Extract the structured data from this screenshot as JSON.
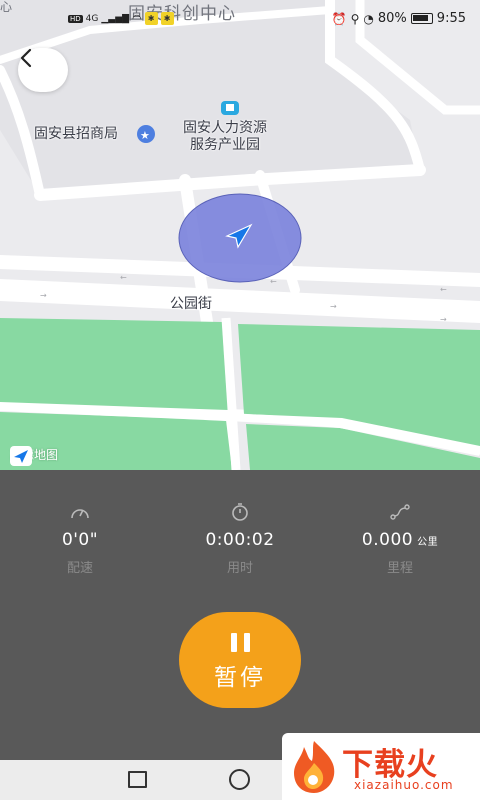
{
  "status_bar": {
    "network_badge": "HD",
    "network_type": "4G",
    "battery": "80%",
    "time": "9:55"
  },
  "map": {
    "top_label": "固安科创中心",
    "corner_fragment": "心",
    "poi_merchant": "固安县招商局",
    "poi_hr_line1": "固安人力资源",
    "poi_hr_line2": "服务产业园",
    "street_label": "公园街",
    "provider_label": "高德地图"
  },
  "stats": {
    "pace": {
      "value": "0'0\"",
      "label": "配速"
    },
    "time": {
      "value": "0:00:02",
      "label": "用时"
    },
    "distance": {
      "value": "0.000",
      "unit": "公里",
      "label": "里程"
    }
  },
  "control": {
    "pause_label": "暂停"
  },
  "watermark": {
    "text": "下载火",
    "sub": "xiazaihuo.com"
  },
  "colors": {
    "accent": "#f4a11a",
    "panel": "#595959",
    "park": "#88d9a2",
    "location": "#7a82dc"
  }
}
